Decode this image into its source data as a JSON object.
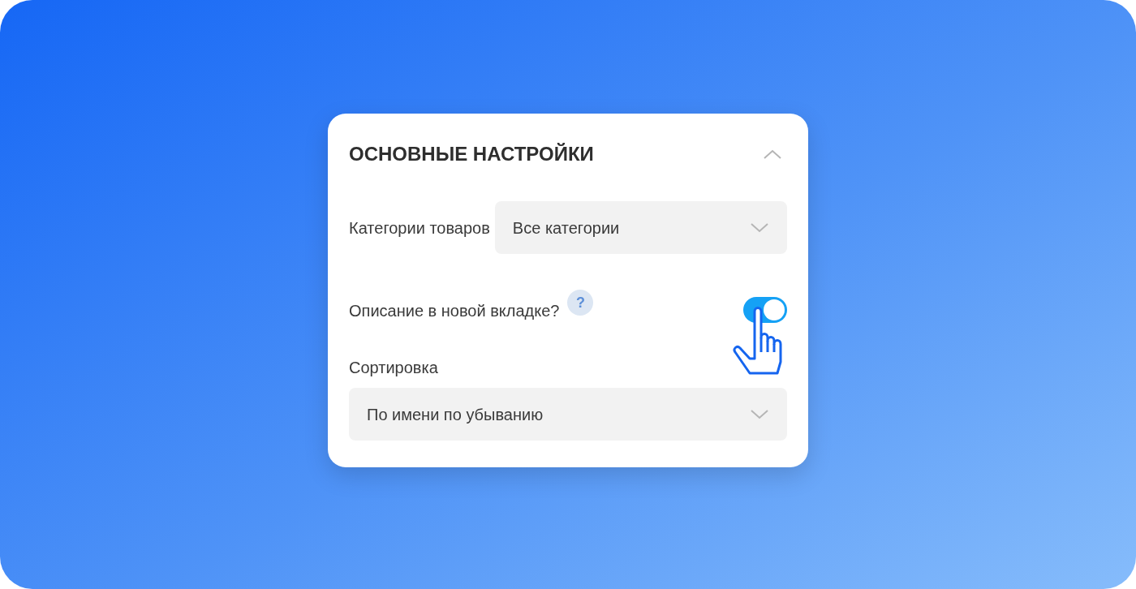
{
  "panel": {
    "title": "ОСНОВНЫЕ НАСТРОЙКИ",
    "expanded": true,
    "fields": [
      {
        "kind": "inline-select",
        "label": "Категории товаров",
        "value": "Все категории"
      },
      {
        "kind": "toggle",
        "label": "Описание в новой вкладке?",
        "help": "?",
        "on": true
      },
      {
        "kind": "stacked-select",
        "label": "Сортировка",
        "value": "По имени по убыванию"
      }
    ]
  }
}
